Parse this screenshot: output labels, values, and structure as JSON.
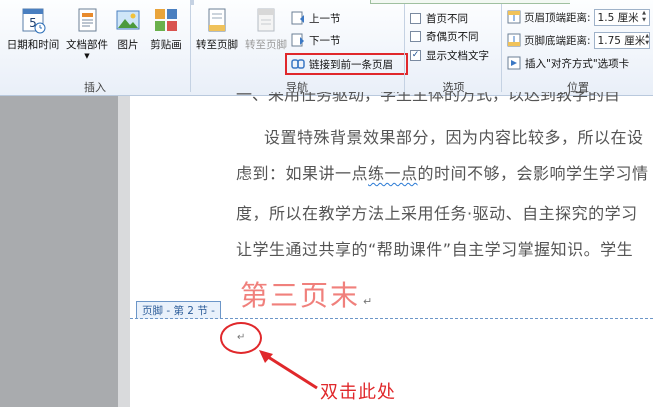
{
  "ribbon": {
    "insert_group": {
      "label": "插入",
      "buttons": [
        {
          "label": "日期和时间",
          "icon": "calendar-icon"
        },
        {
          "label": "文档部件",
          "icon": "document-parts-icon"
        },
        {
          "label": "图片",
          "icon": "picture-icon"
        },
        {
          "label": "剪贴画",
          "icon": "clipart-icon"
        }
      ]
    },
    "nav_group": {
      "label": "导航",
      "goto_footer": "转至页脚",
      "goto_header": "转至页脚",
      "prev_section": "上一节",
      "next_section": "下一节",
      "link_previous": "链接到前一条页眉"
    },
    "options_group": {
      "label": "选项",
      "different_first": "首页不同",
      "different_odd_even": "奇偶页不同",
      "show_doc_text": "显示文档文字",
      "different_first_checked": false,
      "different_odd_even_checked": false,
      "show_doc_text_checked": true
    },
    "position_group": {
      "label": "位置",
      "header_distance_label": "页眉顶端距离:",
      "header_distance_value": "1.5 厘米",
      "footer_distance_label": "页脚底端距离:",
      "footer_distance_value": "1.75 厘米",
      "insert_align_tab": "插入\"对齐方式\"选项卡"
    }
  },
  "document": {
    "top_partial_line": "一、采用任务驱动，学生主体的方式，以达到教学的目",
    "lines": [
      "设置特殊背景效果部分，因为内容比较多，所以在设",
      "虑到：如果讲一点练一点的时间不够，会影响学生学习情",
      "度，所以在教学方法上采用任务·驱动、自主探究的学习",
      "让学生通过共享的“帮助课件”自主学习掌握知识。学生"
    ],
    "line3_pre": "虑到：如果讲一点",
    "line3_wavy": "练一点",
    "line3_post": "的时间不够，会影响学生学习情",
    "page_end_text": "第三页末",
    "paragraph_mark": "↵",
    "footer_tag": "页脚 - 第 2 节 -",
    "footer_return_mark": "↵"
  },
  "annotation": {
    "text": "双击此处",
    "color": "#e0282b"
  }
}
